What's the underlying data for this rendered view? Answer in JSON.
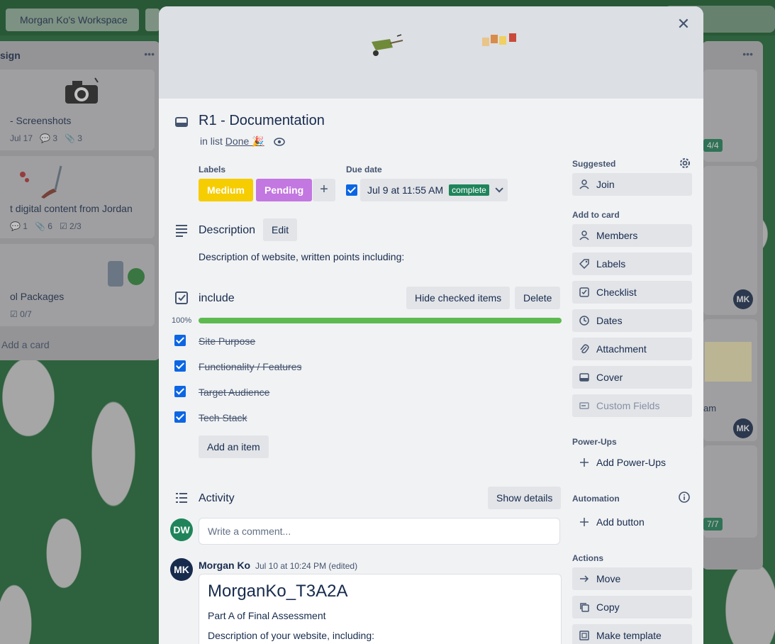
{
  "background": {
    "workspace_name": "Morgan Ko's Workspace",
    "left_list": {
      "title": "sign",
      "cards": [
        {
          "title": "- Screenshots",
          "meta": [
            "Jul 17",
            "3",
            "3"
          ]
        },
        {
          "title": "t digital content from Jordan",
          "meta": [
            "1",
            "6",
            "2/3"
          ]
        },
        {
          "title": "ol Packages",
          "meta": [
            "0/7"
          ]
        }
      ],
      "add_card": "Add a card"
    },
    "right_list": {
      "badges": [
        "4/4",
        "7/7"
      ],
      "avatar": "MK",
      "fragment": "am"
    }
  },
  "card": {
    "title": "R1 - Documentation",
    "in_list_prefix": "in list",
    "list_name": "Done 🎉",
    "labels_heading": "Labels",
    "labels": [
      {
        "text": "Medium",
        "color": "#f5cd00"
      },
      {
        "text": "Pending",
        "color": "#c377e0"
      }
    ],
    "due_heading": "Due date",
    "due_date": "Jul 9 at 11:55 AM",
    "due_status": "complete",
    "description_title": "Description",
    "edit_label": "Edit",
    "description_text": "Description of website, written points including:",
    "checklist": {
      "title": "include",
      "hide_label": "Hide checked items",
      "delete_label": "Delete",
      "progress_text": "100%",
      "progress": 1.0,
      "items": [
        {
          "text": "Site Purpose",
          "checked": true
        },
        {
          "text": "Functionality / Features",
          "checked": true
        },
        {
          "text": "Target Audience",
          "checked": true
        },
        {
          "text": "Tech Stack",
          "checked": true
        }
      ],
      "add_item_label": "Add an item"
    },
    "activity": {
      "title": "Activity",
      "show_details_label": "Show details",
      "current_user_initials": "DW",
      "comment_placeholder": "Write a comment...",
      "comment": {
        "author_initials": "MK",
        "author": "Morgan Ko",
        "meta": "Jul 10 at 10:24 PM (edited)",
        "heading": "MorganKo_T3A2A",
        "paragraphs": [
          "Part A of Final Assessment",
          "Description of your website, including:"
        ]
      }
    }
  },
  "sidebar": {
    "suggested_label": "Suggested",
    "join_label": "Join",
    "add_to_card_label": "Add to card",
    "add_to_card": [
      "Members",
      "Labels",
      "Checklist",
      "Dates",
      "Attachment",
      "Cover",
      "Custom Fields"
    ],
    "powerups_label": "Power-Ups",
    "add_powerups_label": "Add Power-Ups",
    "automation_label": "Automation",
    "add_button_label": "Add button",
    "actions_label": "Actions",
    "actions": [
      "Move",
      "Copy",
      "Make template"
    ]
  },
  "colors": {
    "accent": "#0c66e4",
    "complete": "#1f845a",
    "progress": "#5cba4f",
    "avatar_dw": "#1f845a",
    "avatar_mk": "#172b4d"
  }
}
